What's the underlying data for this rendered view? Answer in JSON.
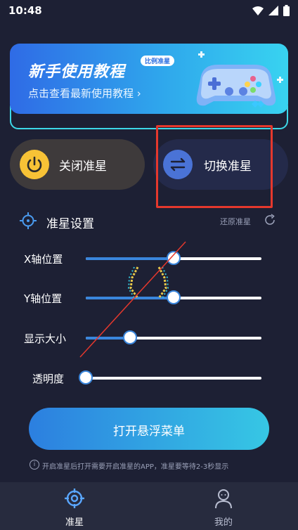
{
  "status": {
    "time": "10:48"
  },
  "banner": {
    "title": "新手使用教程",
    "subtitle": "点击查看最新使用教程 ›",
    "tag": "比例准星",
    "art": "gamepad-illustration"
  },
  "actions": {
    "close_label": "关闭准星",
    "switch_label": "切换准星"
  },
  "settings": {
    "title": "准星设置",
    "restore_label": "还原准星",
    "sliders": [
      {
        "label": "X轴位置",
        "value": 0.5
      },
      {
        "label": "Y轴位置",
        "value": 0.5
      },
      {
        "label": "显示大小",
        "value": 0.25
      },
      {
        "label": "透明度",
        "value": 0.0
      }
    ]
  },
  "open_menu_label": "打开悬浮菜单",
  "notice": "开启准星后打开需要开启准星的APP，准星要等待2-3秒显示",
  "tabs": [
    {
      "label": "准星",
      "icon": "crosshair-icon",
      "active": true
    },
    {
      "label": "我的",
      "icon": "user-icon",
      "active": false
    }
  ],
  "colors": {
    "background": "#1d2034",
    "accent_blue": "#3a86dc",
    "accent_cyan": "#36c7e4",
    "power_yellow": "#f7c236",
    "highlight_red": "#e5382d",
    "tab_active": "#5aa7ff"
  }
}
